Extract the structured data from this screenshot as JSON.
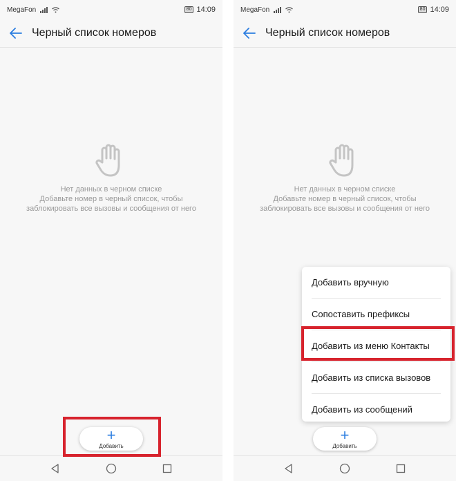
{
  "status": {
    "carrier": "MegaFon",
    "battery": "80",
    "time": "14:09"
  },
  "header": {
    "title": "Черный список номеров"
  },
  "empty": {
    "title": "Нет данных в черном списке",
    "desc_line1": "Добавьте номер в черный список, чтобы",
    "desc_line2": "заблокировать все вызовы и сообщения от него"
  },
  "add_button": {
    "icon": "+",
    "label": "Добавить"
  },
  "menu": {
    "items": [
      "Добавить вручную",
      "Сопоставить префиксы",
      "Добавить из меню Контакты",
      "Добавить из списка вызовов",
      "Добавить из сообщений"
    ]
  },
  "colors": {
    "accent": "#2b7de0",
    "highlight": "#d7232d"
  }
}
